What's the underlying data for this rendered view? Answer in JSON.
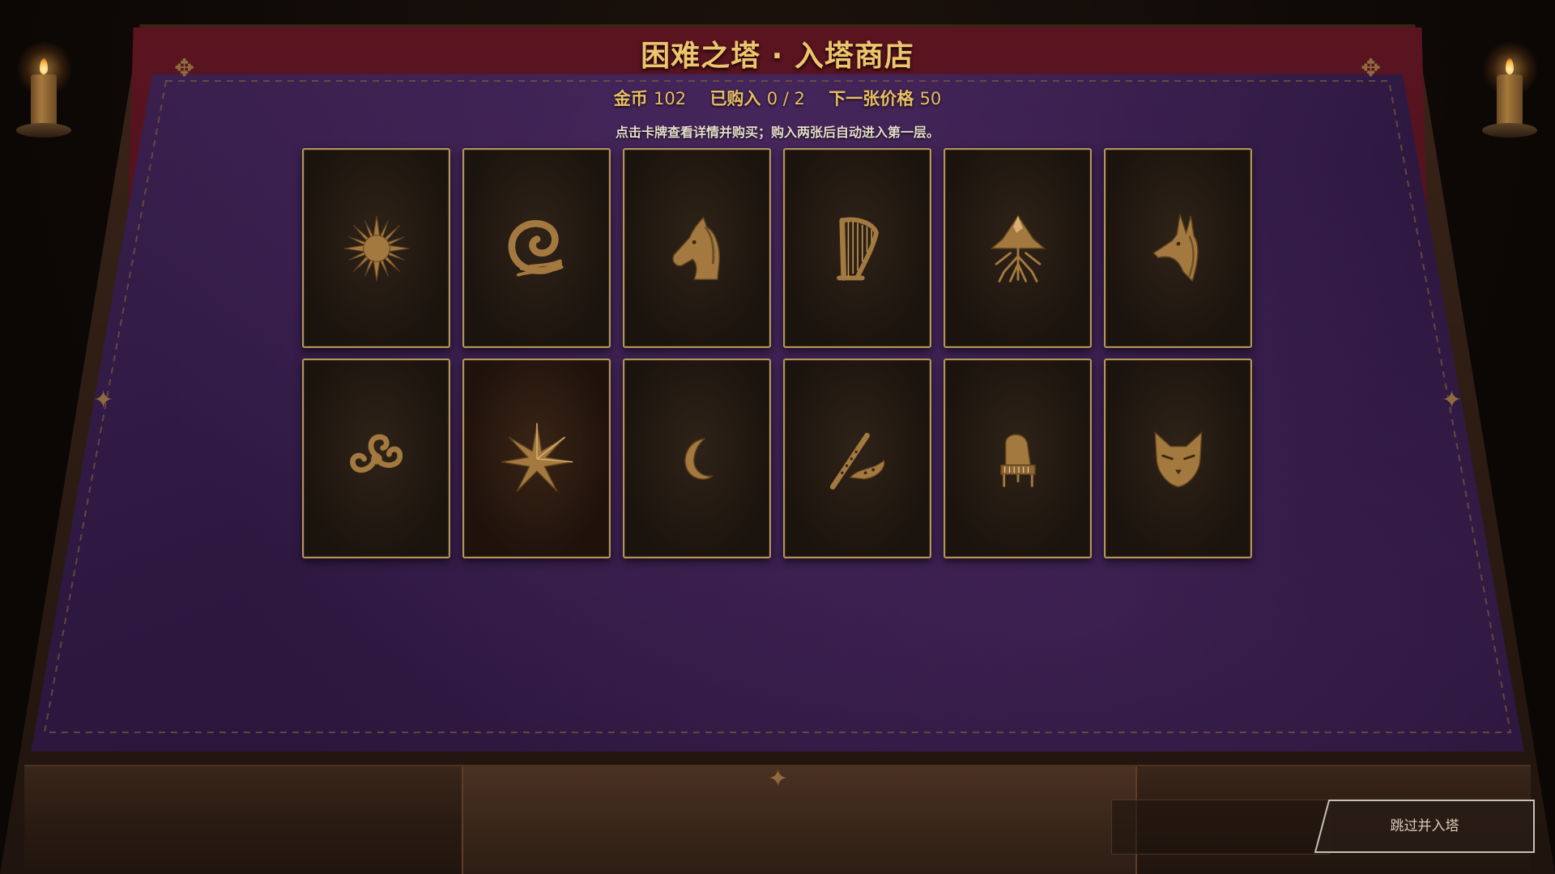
{
  "header": {
    "title": "困难之塔 · 入塔商店",
    "gold_label": "金币",
    "gold_value": "102",
    "bought_label": "已购入",
    "bought_value": "0 / 2",
    "next_price_label": "下一张价格",
    "next_price_value": "50",
    "hint": "点击卡牌查看详情并购买；购入两张后自动进入第一层。"
  },
  "cards": [
    {
      "icon": "sun-icon"
    },
    {
      "icon": "wave-icon"
    },
    {
      "icon": "horse-head-icon"
    },
    {
      "icon": "harp-icon"
    },
    {
      "icon": "mountain-roots-icon"
    },
    {
      "icon": "jackal-head-icon"
    },
    {
      "icon": "triple-spiral-icon"
    },
    {
      "icon": "star-icon"
    },
    {
      "icon": "crescent-moon-icon"
    },
    {
      "icon": "flute-icon"
    },
    {
      "icon": "grand-piano-icon"
    },
    {
      "icon": "cat-head-icon"
    }
  ],
  "skip_button": {
    "label": "跳过并入塔"
  },
  "colors": {
    "gold_text": "#f0c46c",
    "card_border": "#b3955a",
    "cloth_purple": "#2d1840",
    "emblem_bronze": "#a4793f"
  }
}
